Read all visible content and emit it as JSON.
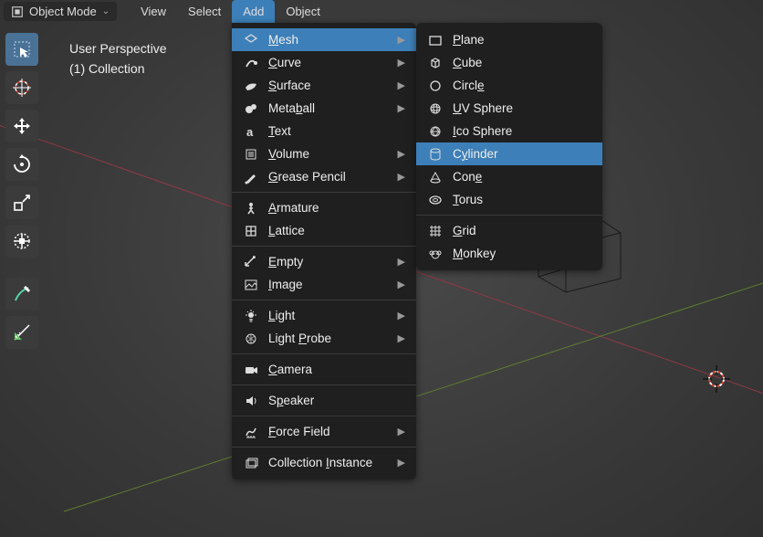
{
  "header": {
    "mode_label": "Object Mode",
    "menu": [
      "View",
      "Select",
      "Add",
      "Object"
    ],
    "active_menu": "Add"
  },
  "viewport_overlay": {
    "line1": "User Perspective",
    "line2": "(1) Collection"
  },
  "add_menu": {
    "highlighted": "Mesh",
    "groups": [
      [
        {
          "icon": "mesh",
          "label": "Mesh",
          "sub": true,
          "hl": true
        },
        {
          "icon": "curve",
          "label": "Curve",
          "sub": true
        },
        {
          "icon": "surface",
          "label": "Surface",
          "sub": true
        },
        {
          "icon": "metaball",
          "label": "Metaball",
          "sub": true
        },
        {
          "icon": "text",
          "label": "Text"
        },
        {
          "icon": "volume",
          "label": "Volume",
          "sub": true
        },
        {
          "icon": "gpencil",
          "label": "Grease Pencil",
          "sub": true
        }
      ],
      [
        {
          "icon": "armature",
          "label": "Armature"
        },
        {
          "icon": "lattice",
          "label": "Lattice"
        }
      ],
      [
        {
          "icon": "empty",
          "label": "Empty",
          "sub": true
        },
        {
          "icon": "image",
          "label": "Image",
          "sub": true
        }
      ],
      [
        {
          "icon": "light",
          "label": "Light",
          "sub": true
        },
        {
          "icon": "lightprobe",
          "label": "Light Probe",
          "sub": true
        }
      ],
      [
        {
          "icon": "camera",
          "label": "Camera"
        }
      ],
      [
        {
          "icon": "speaker",
          "label": "Speaker"
        }
      ],
      [
        {
          "icon": "forcefield",
          "label": "Force Field",
          "sub": true
        }
      ],
      [
        {
          "icon": "collection",
          "label": "Collection Instance",
          "sub": true
        }
      ]
    ],
    "underline_map": {
      "Mesh": 0,
      "Curve": 0,
      "Surface": 0,
      "Metaball": 4,
      "Text": 0,
      "Volume": 0,
      "Grease Pencil": 0,
      "Armature": 0,
      "Lattice": 0,
      "Empty": 0,
      "Image": 0,
      "Light": 0,
      "Light Probe": 6,
      "Camera": 0,
      "Speaker": 1,
      "Force Field": 0,
      "Collection Instance": 11
    }
  },
  "mesh_menu": {
    "highlighted": "Cylinder",
    "groups": [
      [
        {
          "icon": "plane",
          "label": "Plane"
        },
        {
          "icon": "cube",
          "label": "Cube"
        },
        {
          "icon": "circle",
          "label": "Circle"
        },
        {
          "icon": "uvsphere",
          "label": "UV Sphere"
        },
        {
          "icon": "icosphere",
          "label": "Ico Sphere"
        },
        {
          "icon": "cylinder",
          "label": "Cylinder",
          "hl": true
        },
        {
          "icon": "cone",
          "label": "Cone"
        },
        {
          "icon": "torus",
          "label": "Torus"
        }
      ],
      [
        {
          "icon": "grid",
          "label": "Grid"
        },
        {
          "icon": "monkey",
          "label": "Monkey"
        }
      ]
    ],
    "underline_map": {
      "Plane": 0,
      "Cube": 0,
      "Circle": 5,
      "UV Sphere": 0,
      "Ico Sphere": 0,
      "Cylinder": 1,
      "Cone": 3,
      "Torus": 0,
      "Grid": 0,
      "Monkey": 0
    }
  },
  "toolbar": [
    {
      "name": "select-box",
      "active": true
    },
    {
      "name": "cursor"
    },
    {
      "name": "move"
    },
    {
      "name": "rotate"
    },
    {
      "name": "scale"
    },
    {
      "name": "transform"
    },
    {
      "name": "annotate",
      "spacer_before": true
    },
    {
      "name": "measure"
    }
  ],
  "colors": {
    "accent": "#3d7fb8",
    "panel": "#1f1f1f",
    "bg": "#393939"
  }
}
